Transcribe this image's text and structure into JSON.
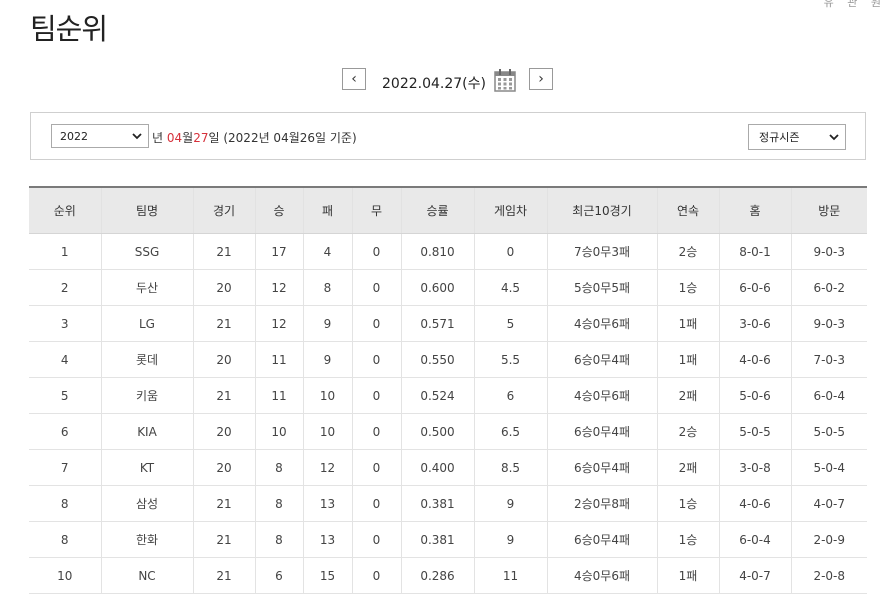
{
  "page": {
    "title": "팀순위"
  },
  "top_links": [
    "유",
    "관",
    "원"
  ],
  "date_nav": {
    "prev_symbol": "‹",
    "next_symbol": "›",
    "current_date": "2022.04.27(수)",
    "calendar_icon": "calendar-icon"
  },
  "filter": {
    "year": "2022",
    "label_year": "년",
    "month": "04",
    "label_month": "월",
    "day": "27",
    "label_day": "일",
    "basis": "(2022년 04월26일 기준)",
    "season": "정규시즌"
  },
  "table": {
    "headers": [
      "순위",
      "팀명",
      "경기",
      "승",
      "패",
      "무",
      "승률",
      "게임차",
      "최근10경기",
      "연속",
      "홈",
      "방문"
    ],
    "rows": [
      [
        "1",
        "SSG",
        "21",
        "17",
        "4",
        "0",
        "0.810",
        "0",
        "7승0무3패",
        "2승",
        "8-0-1",
        "9-0-3"
      ],
      [
        "2",
        "두산",
        "20",
        "12",
        "8",
        "0",
        "0.600",
        "4.5",
        "5승0무5패",
        "1승",
        "6-0-6",
        "6-0-2"
      ],
      [
        "3",
        "LG",
        "21",
        "12",
        "9",
        "0",
        "0.571",
        "5",
        "4승0무6패",
        "1패",
        "3-0-6",
        "9-0-3"
      ],
      [
        "4",
        "롯데",
        "20",
        "11",
        "9",
        "0",
        "0.550",
        "5.5",
        "6승0무4패",
        "1패",
        "4-0-6",
        "7-0-3"
      ],
      [
        "5",
        "키움",
        "21",
        "11",
        "10",
        "0",
        "0.524",
        "6",
        "4승0무6패",
        "2패",
        "5-0-6",
        "6-0-4"
      ],
      [
        "6",
        "KIA",
        "20",
        "10",
        "10",
        "0",
        "0.500",
        "6.5",
        "6승0무4패",
        "2승",
        "5-0-5",
        "5-0-5"
      ],
      [
        "7",
        "KT",
        "20",
        "8",
        "12",
        "0",
        "0.400",
        "8.5",
        "6승0무4패",
        "2패",
        "3-0-8",
        "5-0-4"
      ],
      [
        "8",
        "삼성",
        "21",
        "8",
        "13",
        "0",
        "0.381",
        "9",
        "2승0무8패",
        "1승",
        "4-0-6",
        "4-0-7"
      ],
      [
        "8",
        "한화",
        "21",
        "8",
        "13",
        "0",
        "0.381",
        "9",
        "6승0무4패",
        "1승",
        "6-0-4",
        "2-0-9"
      ],
      [
        "10",
        "NC",
        "21",
        "6",
        "15",
        "0",
        "0.286",
        "11",
        "4승0무6패",
        "1패",
        "4-0-7",
        "2-0-8"
      ]
    ]
  },
  "colors": {
    "accent_red": "#d6313b",
    "header_bg": "#e9e9e9"
  }
}
